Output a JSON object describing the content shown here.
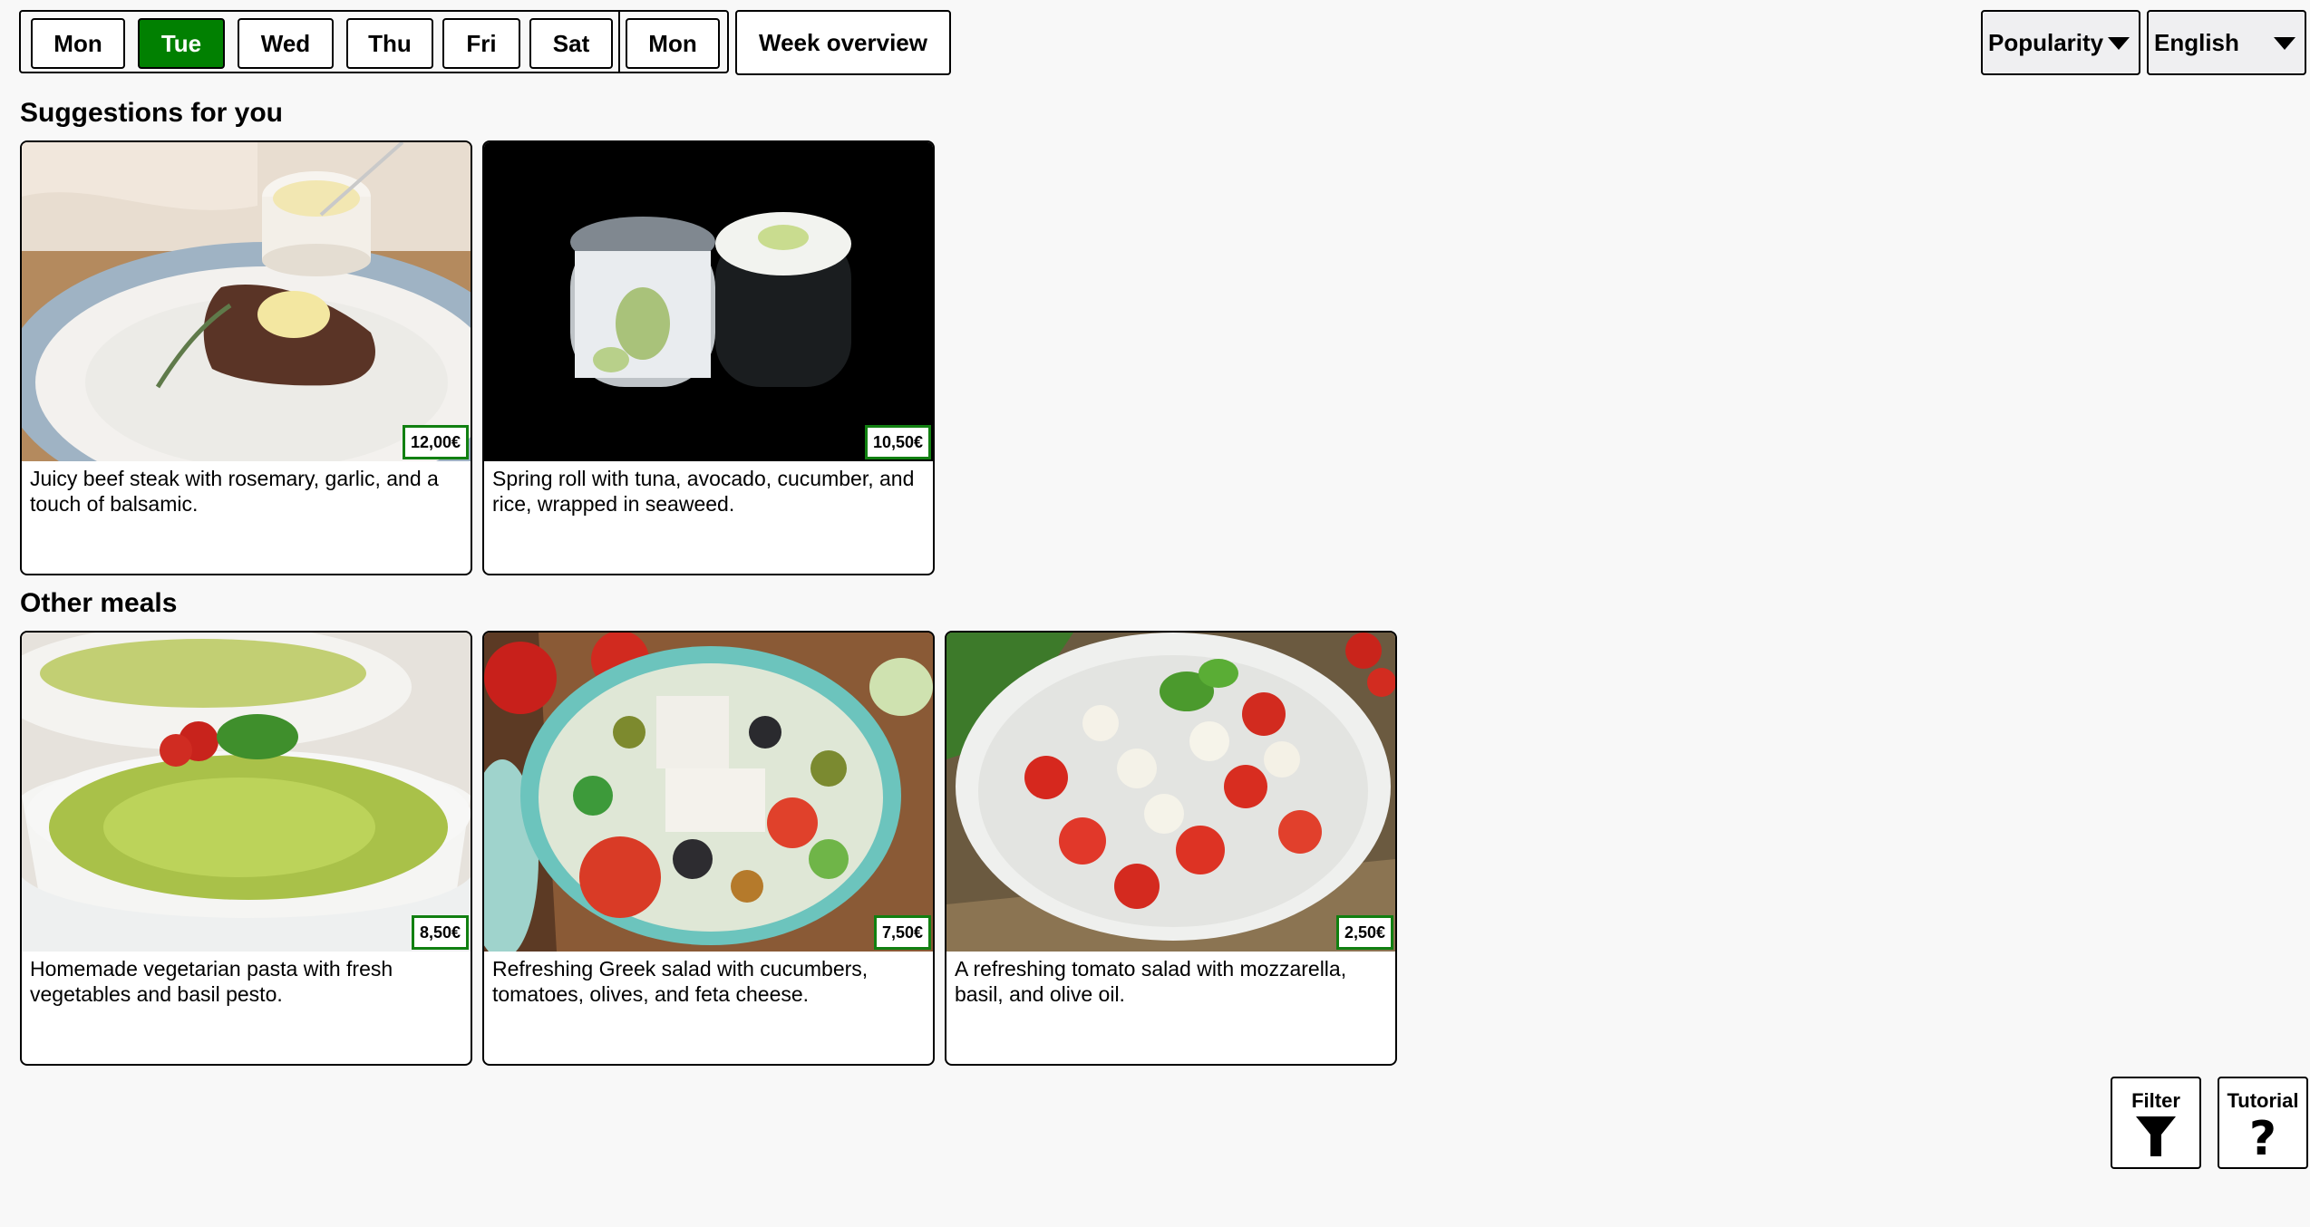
{
  "days": [
    {
      "label": "Mon",
      "active": false
    },
    {
      "label": "Tue",
      "active": true
    },
    {
      "label": "Wed",
      "active": false
    },
    {
      "label": "Thu",
      "active": false
    },
    {
      "label": "Fri",
      "active": false
    },
    {
      "label": "Sat",
      "active": false
    },
    {
      "label": "Mon",
      "active": false
    }
  ],
  "week_overview": "Week overview",
  "sort": {
    "selected": "Popularity"
  },
  "language": {
    "selected": "English"
  },
  "suggestions": {
    "title": "Suggestions for you",
    "items": [
      {
        "price": "12,00€",
        "description": "Juicy beef steak with rosemary, garlic, and a touch of balsamic.",
        "image": "beef-steak-photo"
      },
      {
        "price": "10,50€",
        "description": "Spring roll with tuna, avocado, cucumber, and rice, wrapped in seaweed.",
        "image": "sushi-roll-photo"
      }
    ]
  },
  "other": {
    "title": "Other meals",
    "items": [
      {
        "price": "8,50€",
        "description": "Homemade vegetarian pasta with fresh vegetables and basil pesto.",
        "image": "pesto-pasta-photo"
      },
      {
        "price": "7,50€",
        "description": "Refreshing Greek salad with cucumbers, tomatoes, olives, and feta cheese.",
        "image": "greek-salad-photo"
      },
      {
        "price": "2,50€",
        "description": "A refreshing tomato salad with mozzarella, basil, and olive oil.",
        "image": "tomato-mozzarella-salad-photo"
      }
    ]
  },
  "buttons": {
    "filter": "Filter",
    "tutorial": "Tutorial"
  },
  "colors": {
    "active_day": "#018001",
    "price_border": "#118011",
    "background": "#f8f8f8"
  }
}
